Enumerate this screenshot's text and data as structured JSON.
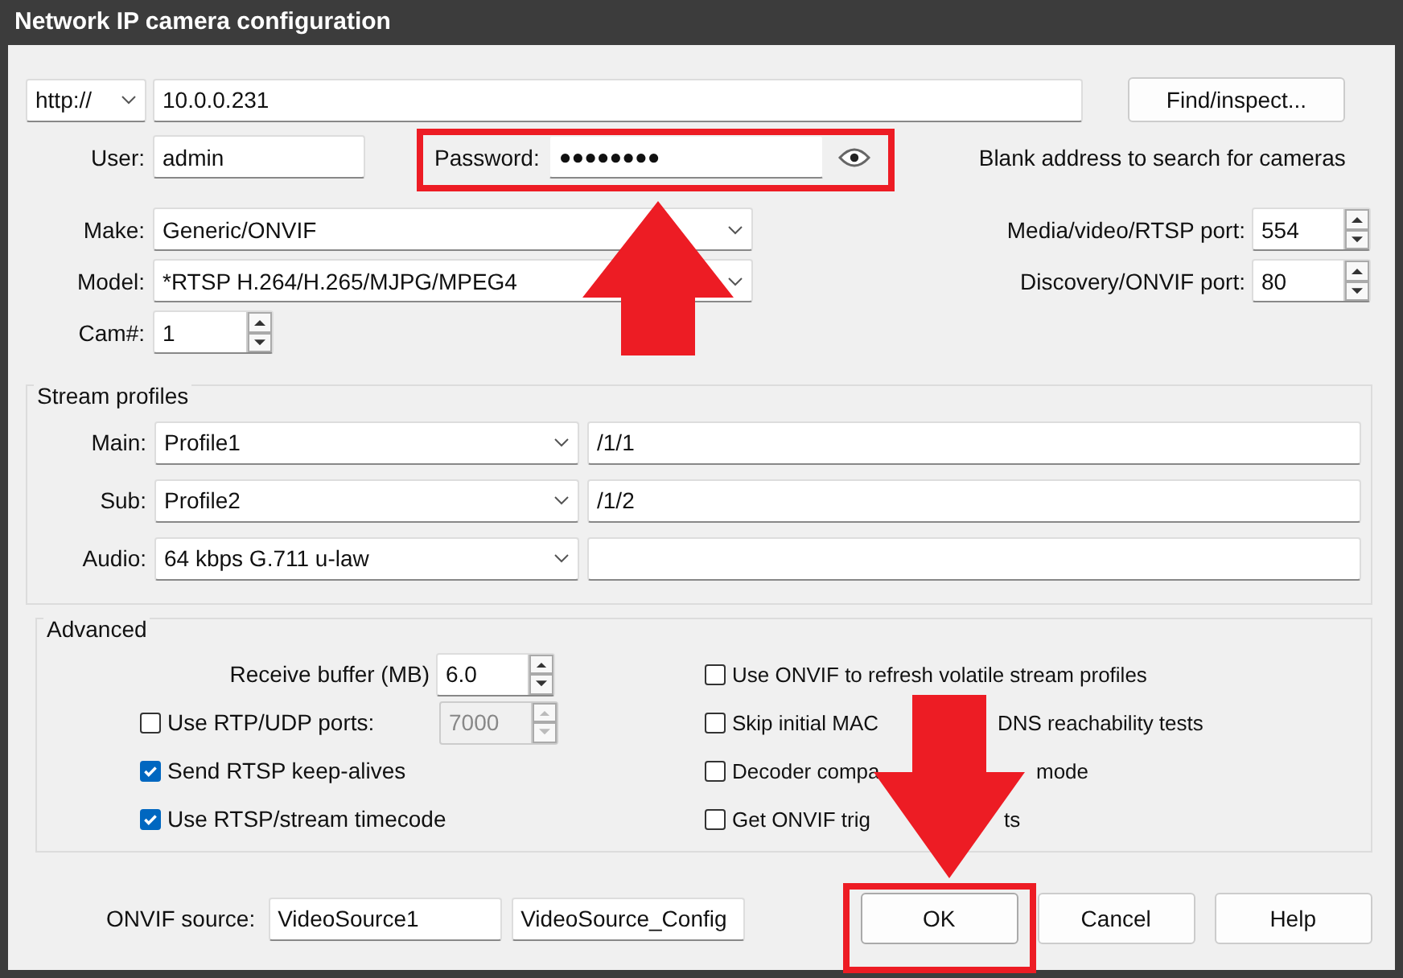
{
  "window": {
    "title": "Network IP camera configuration"
  },
  "address": {
    "scheme": "http://",
    "host": "10.0.0.231",
    "find_button": "Find/inspect..."
  },
  "login": {
    "user_label": "User:",
    "user": "admin",
    "password_label": "Password:",
    "password": "●●●●●●●●",
    "hint": "Blank address to search for cameras"
  },
  "device": {
    "make_label": "Make:",
    "make": "Generic/ONVIF",
    "model_label": "Model:",
    "model": "*RTSP H.264/H.265/MJPG/MPEG4",
    "cam_label": "Cam#:",
    "cam": "1"
  },
  "ports": [
    {
      "label": "Media/video/RTSP port:",
      "value": "554"
    },
    {
      "label": "Discovery/ONVIF port:",
      "value": "80"
    }
  ],
  "stream_profiles": {
    "title": "Stream profiles",
    "rows": [
      {
        "label": "Main:",
        "profile": "Profile1",
        "path": "/1/1"
      },
      {
        "label": "Sub:",
        "profile": "Profile2",
        "path": "/1/2"
      },
      {
        "label": "Audio:",
        "profile": "64 kbps G.711 u-law",
        "path": ""
      }
    ]
  },
  "advanced": {
    "title": "Advanced",
    "buffer_label": "Receive buffer (MB)",
    "buffer": "6.0",
    "left_options": [
      {
        "kind": "checkbox-spin",
        "label": "Use RTP/UDP ports:",
        "checked": false,
        "value": "7000",
        "disabled": true
      },
      {
        "kind": "checkbox",
        "label": "Send RTSP keep-alives",
        "checked": true
      },
      {
        "kind": "checkbox",
        "label": "Use RTSP/stream timecode",
        "checked": true
      }
    ],
    "right_options": [
      {
        "label": "Use ONVIF to refresh volatile stream profiles",
        "checked": false
      },
      {
        "label": "Skip initial MAC",
        "label_tail": "DNS reachability tests",
        "checked": false
      },
      {
        "label": "Decoder compa",
        "label_tail": "mode",
        "checked": false
      },
      {
        "label": "Get ONVIF trig",
        "label_tail": "ts",
        "checked": false
      }
    ]
  },
  "onvif_source": {
    "label": "ONVIF source:",
    "source": "VideoSource1",
    "config": "VideoSource_Config"
  },
  "buttons": [
    {
      "label": "OK",
      "default": true
    },
    {
      "label": "Cancel",
      "default": false
    },
    {
      "label": "Help",
      "default": false
    }
  ]
}
